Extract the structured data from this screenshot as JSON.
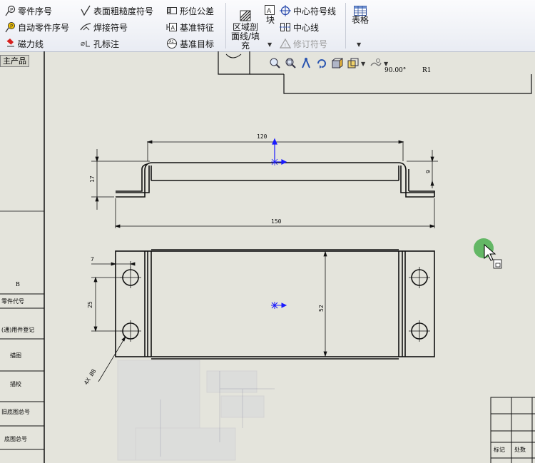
{
  "toolbar": {
    "col1": {
      "balloon": "零件序号",
      "auto_balloon": "自动零件序号",
      "magnetic_line": "磁力线"
    },
    "col2": {
      "surface_finish": "表面粗糙度符号",
      "weld_symbol": "焊接符号",
      "hole_callout": "孔标注"
    },
    "col3": {
      "geometric_tolerance": "形位公差",
      "datum_feature": "基准特征",
      "datum_target": "基准目标"
    },
    "area_hatch": "区域剖面线/填充",
    "block": "块",
    "col5": {
      "center_mark": "中心符号线",
      "centerline": "中心线",
      "revision_symbol": "修订符号"
    },
    "table": "表格"
  },
  "tab": {
    "label": "主产品"
  },
  "view_toolbar": {
    "icons": [
      "zoom-to-fit-icon",
      "zoom-to-area-icon",
      "zoom-pan-icon",
      "rotate-icon",
      "display-style-icon",
      "hide-show-icon"
    ]
  },
  "drawing": {
    "dims": {
      "top_width": "120",
      "overall_width": "150",
      "height": "17",
      "flange": "9",
      "edge_offset": "7",
      "hole_spacing": "25",
      "plate_height": "52",
      "hole_note": "4X Ø8"
    },
    "header_note": "90.00°",
    "header_r": "R1"
  },
  "left_table": {
    "label_b": "B",
    "rows": [
      "零件代号",
      "(通)用件登记",
      "描图",
      "描校",
      "旧底图总号",
      "底图总号"
    ]
  },
  "title_block": {
    "mark": "标记",
    "count": "处数"
  }
}
